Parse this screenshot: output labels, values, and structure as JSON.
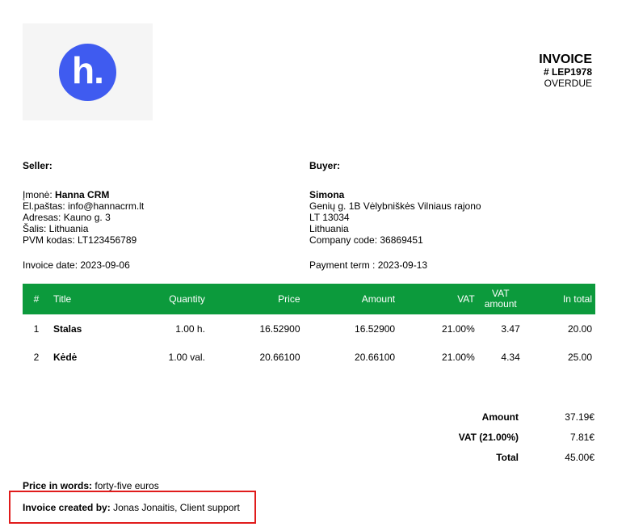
{
  "logo": {
    "glyph": "h.",
    "bg_color": "#3f5bf0"
  },
  "invoice": {
    "title": "INVOICE",
    "number": "# LEP1978",
    "status": "OVERDUE"
  },
  "seller": {
    "heading": "Seller:",
    "company_label": "Įmonė:",
    "company_name": "Hanna CRM",
    "email": "El.paštas: info@hannacrm.lt",
    "address": "Adresas: Kauno g. 3",
    "country": "Šalis: Lithuania",
    "vat_code": "PVM kodas: LT123456789",
    "invoice_date": "Invoice date: 2023-09-06"
  },
  "buyer": {
    "heading": "Buyer:",
    "name": "Simona",
    "address1": "Genių g. 1B Vėlybniškės Vilniaus rajono",
    "address2": "LT 13034",
    "country": "Lithuania",
    "company_code": "Company code: 36869451",
    "payment_term": "Payment term : 2023-09-13"
  },
  "table": {
    "header_color": "#0c9a3c",
    "columns": {
      "num": "#",
      "title": "Title",
      "quantity": "Quantity",
      "price": "Price",
      "amount": "Amount",
      "vat": "VAT",
      "vat_amount": "VAT amount",
      "total": "In total"
    },
    "rows": [
      {
        "num": "1",
        "title": "Stalas",
        "quantity": "1.00 h.",
        "price": "16.52900",
        "amount": "16.52900",
        "vat": "21.00%",
        "vat_amount": "3.47",
        "total": "20.00"
      },
      {
        "num": "2",
        "title": "Kėdė",
        "quantity": "1.00 val.",
        "price": "20.66100",
        "amount": "20.66100",
        "vat": "21.00%",
        "vat_amount": "4.34",
        "total": "25.00"
      }
    ]
  },
  "totals": {
    "amount_label": "Amount",
    "amount_value": "37.19€",
    "vat_label": "VAT (21.00%)",
    "vat_value": "7.81€",
    "total_label": "Total",
    "total_value": "45.00€"
  },
  "price_in_words": {
    "label": "Price in words:",
    "value": "forty-five euros"
  },
  "created_by": {
    "label": "Invoice created by:",
    "value": "Jonas Jonaitis, Client support",
    "highlight_color": "#e01b1b"
  }
}
